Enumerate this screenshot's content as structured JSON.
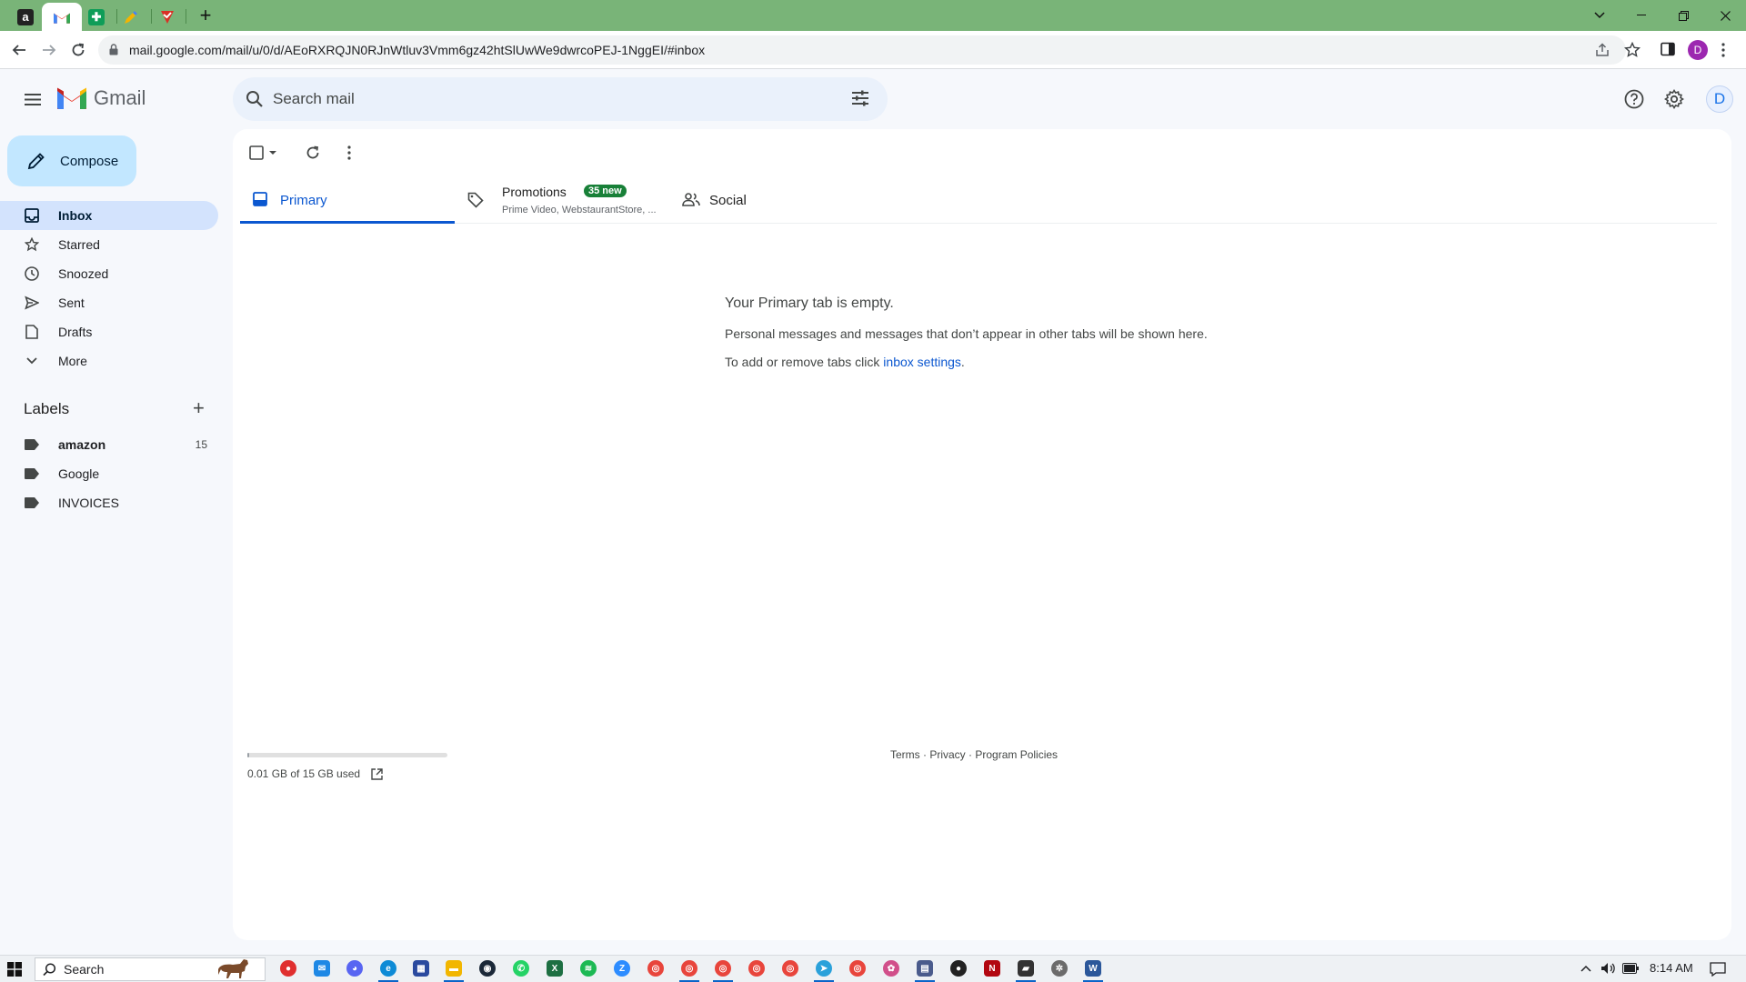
{
  "browser": {
    "url": "mail.google.com/mail/u/0/d/AEoRXRQJN0RJnWtluv3Vmm6gz42htSlUwWe9dwrcoPEJ-1NggEI/#inbox",
    "profile_initial": "D",
    "tabs": [
      {
        "icon": "amazon-favicon-icon",
        "active": false
      },
      {
        "icon": "gmail-favicon-icon",
        "active": true
      },
      {
        "icon": "sheets-favicon-icon",
        "active": false
      },
      {
        "icon": "pencil-favicon-icon",
        "active": false
      },
      {
        "icon": "checkbox-favicon-icon",
        "active": false
      }
    ]
  },
  "header": {
    "app_name": "Gmail",
    "search_placeholder": "Search mail",
    "account_initial": "D"
  },
  "sidebar": {
    "compose_label": "Compose",
    "items": [
      {
        "label": "Inbox",
        "icon": "inbox-icon",
        "active": true
      },
      {
        "label": "Starred",
        "icon": "star-icon"
      },
      {
        "label": "Snoozed",
        "icon": "clock-icon"
      },
      {
        "label": "Sent",
        "icon": "send-icon"
      },
      {
        "label": "Drafts",
        "icon": "draft-icon"
      },
      {
        "label": "More",
        "icon": "chevron-down-icon"
      }
    ],
    "labels_heading": "Labels",
    "labels": [
      {
        "name": "amazon",
        "count": "15",
        "bold": true
      },
      {
        "name": "Google",
        "count": ""
      },
      {
        "name": "INVOICES",
        "count": ""
      }
    ]
  },
  "main": {
    "tabs": [
      {
        "label": "Primary",
        "active": true,
        "icon": "inbox-icon"
      },
      {
        "label": "Promotions",
        "badge": "35 new",
        "subtitle": "Prime Video, WebstaurantStore, ...",
        "icon": "tag-icon"
      },
      {
        "label": "Social",
        "icon": "people-icon"
      }
    ],
    "empty_title": "Your Primary tab is empty.",
    "empty_line1": "Personal messages and messages that don’t appear in other tabs will be shown here.",
    "empty_line2_prefix": "To add or remove tabs click ",
    "empty_line2_link": "inbox settings",
    "empty_line2_suffix": ".",
    "storage_text": "0.01 GB of 15 GB used",
    "storage_used_fraction": 0.001,
    "footer_terms": "Terms",
    "footer_privacy": "Privacy",
    "footer_policies": "Program Policies",
    "footer_sep": " · "
  },
  "taskbar": {
    "search_label": "Search",
    "time": "8:14 AM"
  },
  "colors": {
    "tabstrip": "#79b478",
    "compose": "#c2e7ff",
    "active_nav": "#d3e3fd",
    "accent": "#0b57d0",
    "badge": "#188038"
  }
}
